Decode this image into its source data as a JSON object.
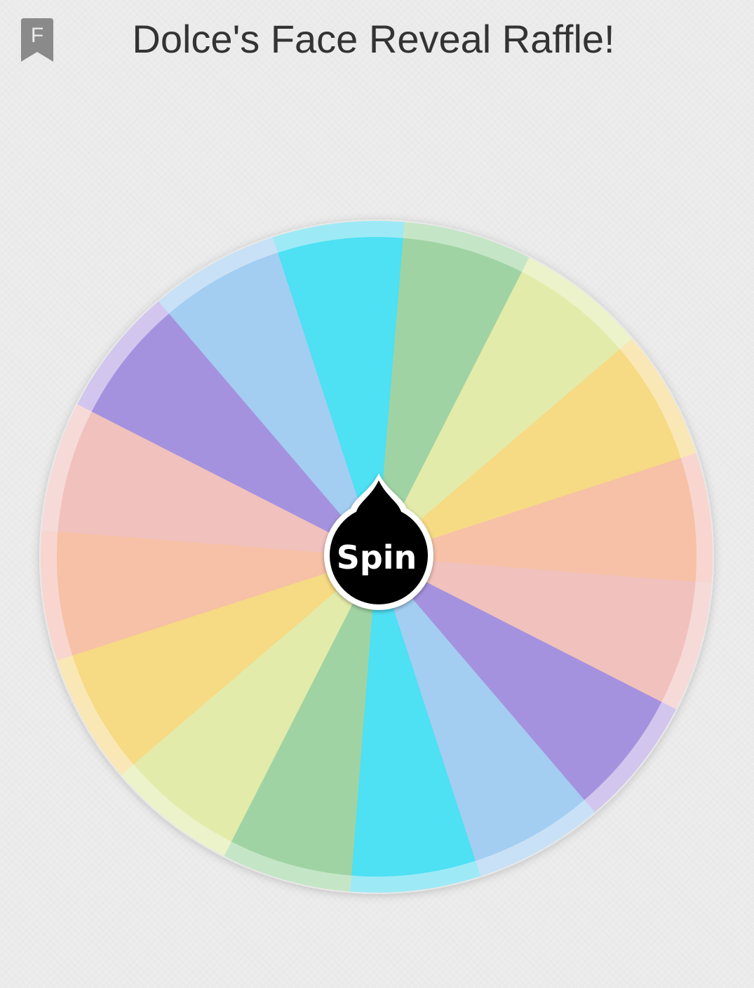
{
  "header": {
    "title": "Dolce's Face Reveal Raffle!",
    "bookmark_letter": "F",
    "bookmark_icon": "bookmark-icon"
  },
  "wheel": {
    "spin_label": "Spin",
    "segment_count": 16,
    "segment_colors": [
      "#a0d3a3",
      "#e3ebaa",
      "#f6da84",
      "#f6c1a6",
      "#f1c1bd",
      "#a592de",
      "#a3cdf1",
      "#4ee0f3",
      "#a0d3a3",
      "#e3ebaa",
      "#f6da84",
      "#f6c1a6",
      "#f1c1bd",
      "#a592de",
      "#a3cdf1",
      "#4ee0f3"
    ],
    "rim_colors": [
      "#c5e6c6",
      "#ecf3cb",
      "#f9e7b6",
      "#f8d6cf",
      "#f6dad8",
      "#d2c6ee",
      "#c8e1f7",
      "#9deaf6",
      "#c5e6c6",
      "#ecf3cb",
      "#f9e7b6",
      "#f8d6cf",
      "#f6dad8",
      "#d2c6ee",
      "#c8e1f7",
      "#9deaf6"
    ],
    "hub_color": "#000000",
    "hub_border_color": "#ffffff"
  }
}
